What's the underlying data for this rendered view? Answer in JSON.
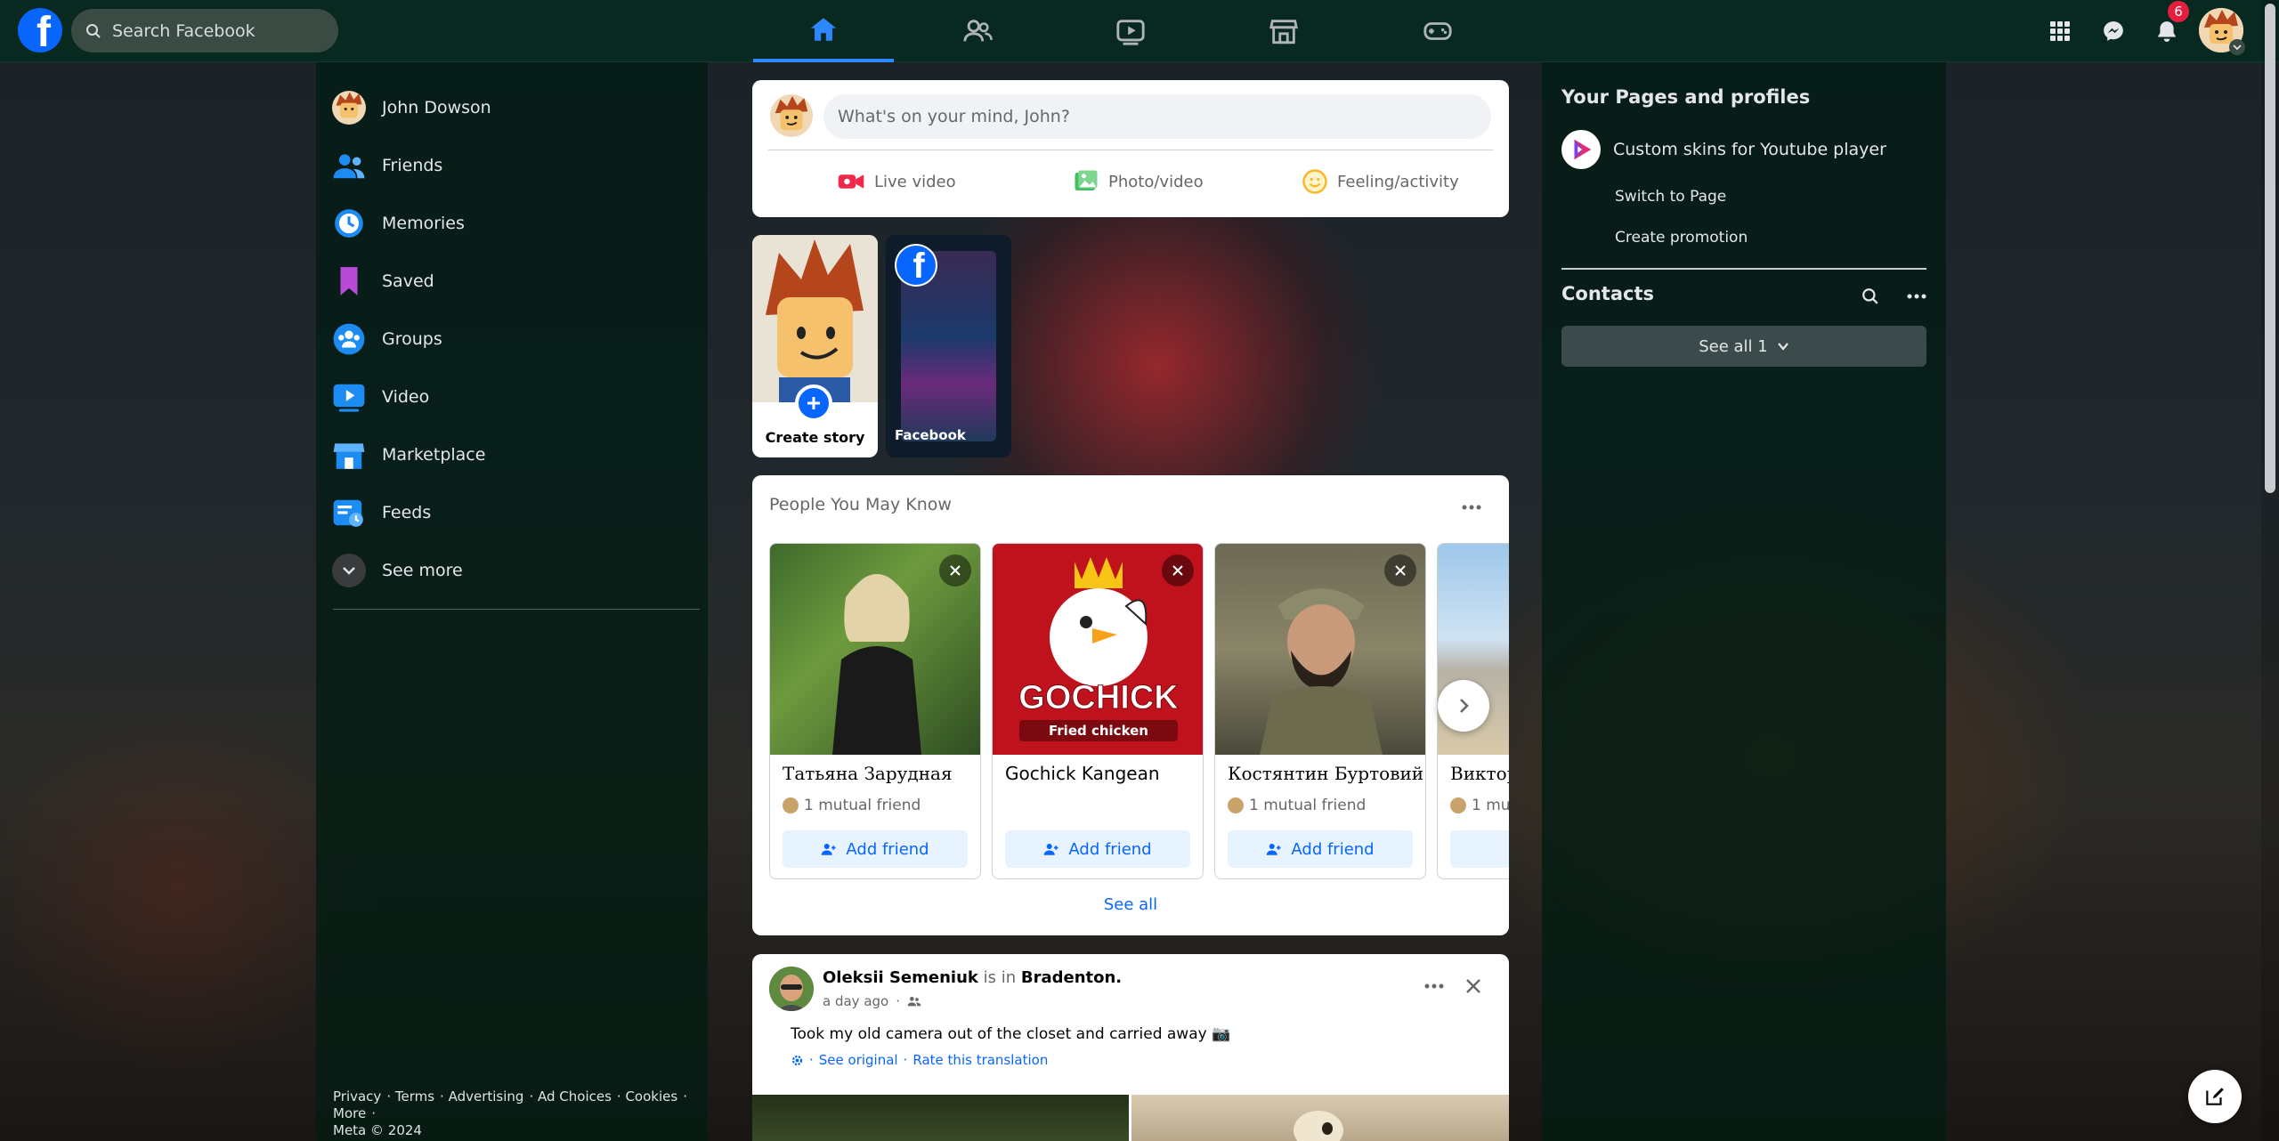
{
  "search": {
    "placeholder": "Search Facebook"
  },
  "nav": {
    "tabs": [
      {
        "name": "home",
        "active": true
      },
      {
        "name": "friends"
      },
      {
        "name": "watch"
      },
      {
        "name": "marketplace"
      },
      {
        "name": "gaming"
      }
    ]
  },
  "header": {
    "notifications_badge": "6"
  },
  "sidebar": {
    "items": [
      {
        "label": "John Dowson",
        "icon": "avatar"
      },
      {
        "label": "Friends",
        "icon": "friends-icon"
      },
      {
        "label": "Memories",
        "icon": "clock-icon"
      },
      {
        "label": "Saved",
        "icon": "bookmark-icon"
      },
      {
        "label": "Groups",
        "icon": "groups-icon"
      },
      {
        "label": "Video",
        "icon": "video-icon"
      },
      {
        "label": "Marketplace",
        "icon": "shop-icon"
      },
      {
        "label": "Feeds",
        "icon": "feeds-icon"
      },
      {
        "label": "See more",
        "icon": "chevron-down-icon"
      }
    ]
  },
  "footer": {
    "links": [
      "Privacy",
      "Terms",
      "Advertising",
      "Ad Choices",
      "Cookies",
      "More"
    ],
    "copyright": "Meta © 2024"
  },
  "composer": {
    "placeholder": "What's on your mind, John?",
    "actions": [
      "Live video",
      "Photo/video",
      "Feeling/activity"
    ]
  },
  "stories": {
    "create_label": "Create story",
    "story_owner": "Facebook"
  },
  "pymk": {
    "title": "People You May Know",
    "see_all": "See all",
    "people": [
      {
        "name": "Татьяна Зарудная",
        "mutual": "1 mutual friend",
        "button": "Add friend"
      },
      {
        "name": "Gochick Kangean",
        "mutual": "",
        "button": "Add friend",
        "logo_text": "GOCHICK",
        "logo_sub": "Fried chicken"
      },
      {
        "name": "Костянтин Буртовий",
        "mutual": "1 mutual friend",
        "button": "Add friend"
      },
      {
        "name": "Виктор",
        "mutual": "1 mu",
        "button": ""
      }
    ]
  },
  "post": {
    "author": "Oleksii Semeniuk",
    "verb": "is in",
    "place": "Bradenton.",
    "time": "a day ago",
    "text": "Took my old camera out of the closet and carried away 📷",
    "see_original": "See original",
    "rate": "Rate this translation"
  },
  "right": {
    "pages_title": "Your Pages and profiles",
    "page_name": "Custom skins for Youtube player",
    "switch": "Switch to Page",
    "promo": "Create promotion",
    "contacts_title": "Contacts",
    "see_all": "See all 1"
  },
  "colors": {
    "topbar": "#08291f",
    "accent": "#2d88ff",
    "brand": "#0866ff",
    "badge": "#e41e3f"
  }
}
